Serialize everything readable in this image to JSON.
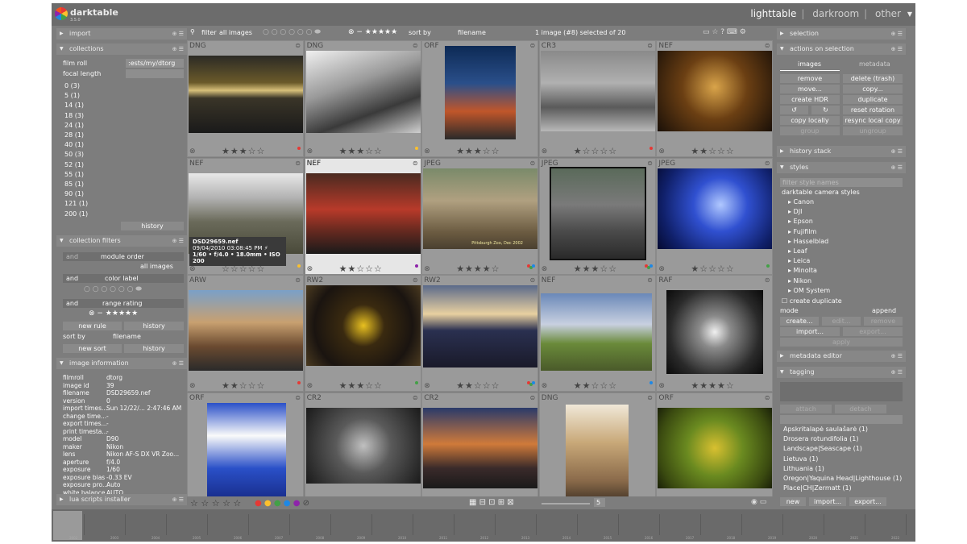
{
  "app": {
    "name": "darktable",
    "version": "3.5.0",
    "views": [
      "lighttable",
      "darkroom",
      "other"
    ],
    "active_view": "lighttable"
  },
  "toolbar": {
    "filter_label": "filter",
    "filter_value": "all images",
    "sort_label": "sort by",
    "sort_value": "filename",
    "selection_text": "1 image (#8) selected of 20",
    "zoom_value": "5"
  },
  "left": {
    "import": "import",
    "collections": "collections",
    "film_roll_label": "film roll",
    "film_roll_value": ":ests/my/dtorg",
    "focal_label": "focal length",
    "focal_items": [
      "0 (3)",
      "5 (1)",
      "14 (1)",
      "18 (3)",
      "24 (1)",
      "28 (1)",
      "40 (1)",
      "50 (3)",
      "52 (1)",
      "55 (1)",
      "85 (1)",
      "90 (1)",
      "121 (1)",
      "200 (1)"
    ],
    "history": "history",
    "collection_filters": "collection filters",
    "and": "and",
    "module_order": "module order",
    "all_images": "all images",
    "color_label": "color label",
    "range_rating": "range rating",
    "new_rule": "new rule",
    "sort_by": "sort by",
    "filename": "filename",
    "new_sort": "new sort",
    "image_information": "image information",
    "info": [
      {
        "k": "filmroll",
        "v": "dtorg"
      },
      {
        "k": "image id",
        "v": "39"
      },
      {
        "k": "filename",
        "v": "DSD29659.nef"
      },
      {
        "k": "version",
        "v": "0"
      },
      {
        "k": "import times...",
        "v": "Sun 12/22/... 2:47:46 AM"
      },
      {
        "k": "change time...",
        "v": "-"
      },
      {
        "k": "export times...",
        "v": "-"
      },
      {
        "k": "print timesta...",
        "v": "-"
      },
      {
        "k": "model",
        "v": "D90"
      },
      {
        "k": "maker",
        "v": "Nikon"
      },
      {
        "k": "lens",
        "v": "Nikon AF-S DX VR Zoo..."
      },
      {
        "k": "aperture",
        "v": "f/4.0"
      },
      {
        "k": "exposure",
        "v": "1/60"
      },
      {
        "k": "exposure bias",
        "v": "-0.33 EV"
      },
      {
        "k": "exposure pro...",
        "v": "Auto"
      },
      {
        "k": "white balance",
        "v": "AUTO"
      }
    ],
    "lua": "lua scripts installer"
  },
  "right": {
    "selection": "selection",
    "actions": "actions on selection",
    "tab_images": "images",
    "tab_metadata": "metadata",
    "buttons": [
      "remove",
      "delete (trash)",
      "move...",
      "copy...",
      "create HDR",
      "duplicate",
      "↺",
      "↻",
      "reset rotation",
      "copy locally",
      "resync local copy",
      "group",
      "ungroup"
    ],
    "history_stack": "history stack",
    "styles": "styles",
    "filter_styles": "filter style names",
    "styles_root": "darktable camera styles",
    "style_items": [
      "Canon",
      "DJI",
      "Epson",
      "Fujifilm",
      "Hasselblad",
      "Leaf",
      "Leica",
      "Minolta",
      "Nikon",
      "OM System"
    ],
    "create_duplicate": "create duplicate",
    "mode": "mode",
    "mode_value": "append",
    "create": "create...",
    "edit": "edit...",
    "remove": "remove",
    "import": "import...",
    "export": "export...",
    "apply": "apply",
    "metadata_editor": "metadata editor",
    "tagging": "tagging",
    "attach": "attach",
    "detach": "detach",
    "tags": [
      "Apskritalapė saulašarė (1)",
      "Drosera rotundifolia (1)",
      "Landscape|Seascape (1)",
      "Lietuva (1)",
      "Lithuania (1)",
      "Oregon|Yaquina Head|Lighthouse (1)",
      "Place|CH|Zermatt (1)"
    ],
    "new": "new",
    "import2": "import...",
    "export2": "export..."
  },
  "grid": [
    {
      "ext": "DNG",
      "stars": 3,
      "label": "red"
    },
    {
      "ext": "DNG",
      "stars": 3,
      "label": "yellow"
    },
    {
      "ext": "ORF",
      "stars": 3,
      "label": ""
    },
    {
      "ext": "CR3",
      "stars": 1,
      "label": "red"
    },
    {
      "ext": "NEF",
      "stars": 2,
      "label": ""
    },
    {
      "ext": "NEF",
      "stars": 0,
      "label": "yellow"
    },
    {
      "ext": "NEF",
      "stars": 2,
      "label": "purple"
    },
    {
      "ext": "JPEG",
      "stars": 4,
      "label": "multi"
    },
    {
      "ext": "JPEG",
      "stars": 3,
      "label": "multi"
    },
    {
      "ext": "JPEG",
      "stars": 1,
      "label": "green"
    },
    {
      "ext": "ARW",
      "stars": 2,
      "label": "red"
    },
    {
      "ext": "RW2",
      "stars": 3,
      "label": "green"
    },
    {
      "ext": "RW2",
      "stars": 2,
      "label": "multi"
    },
    {
      "ext": "NEF",
      "stars": 2,
      "label": "blue"
    },
    {
      "ext": "RAF",
      "stars": 4,
      "label": ""
    },
    {
      "ext": "ORF",
      "stars": 0,
      "label": ""
    },
    {
      "ext": "CR2",
      "stars": 0,
      "label": ""
    },
    {
      "ext": "CR2",
      "stars": 0,
      "label": ""
    },
    {
      "ext": "DNG",
      "stars": 0,
      "label": ""
    },
    {
      "ext": "ORF",
      "stars": 0,
      "label": ""
    }
  ],
  "tooltip": {
    "line1": "DSD29659.nef",
    "line2": "09/04/2010 03:08:45 PM ⚡",
    "line3": "1/60 • f/4.0 • 18.0mm • ISO 200"
  },
  "thumb_caption": "Pittsburgh Zoo, Dec 2002",
  "timeline": [
    "2002",
    "2003",
    "2004",
    "2005",
    "2006",
    "2007",
    "2008",
    "2009",
    "2010",
    "2011",
    "2012",
    "2013",
    "2014",
    "2015",
    "2016",
    "2017",
    "2018",
    "2019",
    "2020",
    "2021",
    "2022"
  ]
}
